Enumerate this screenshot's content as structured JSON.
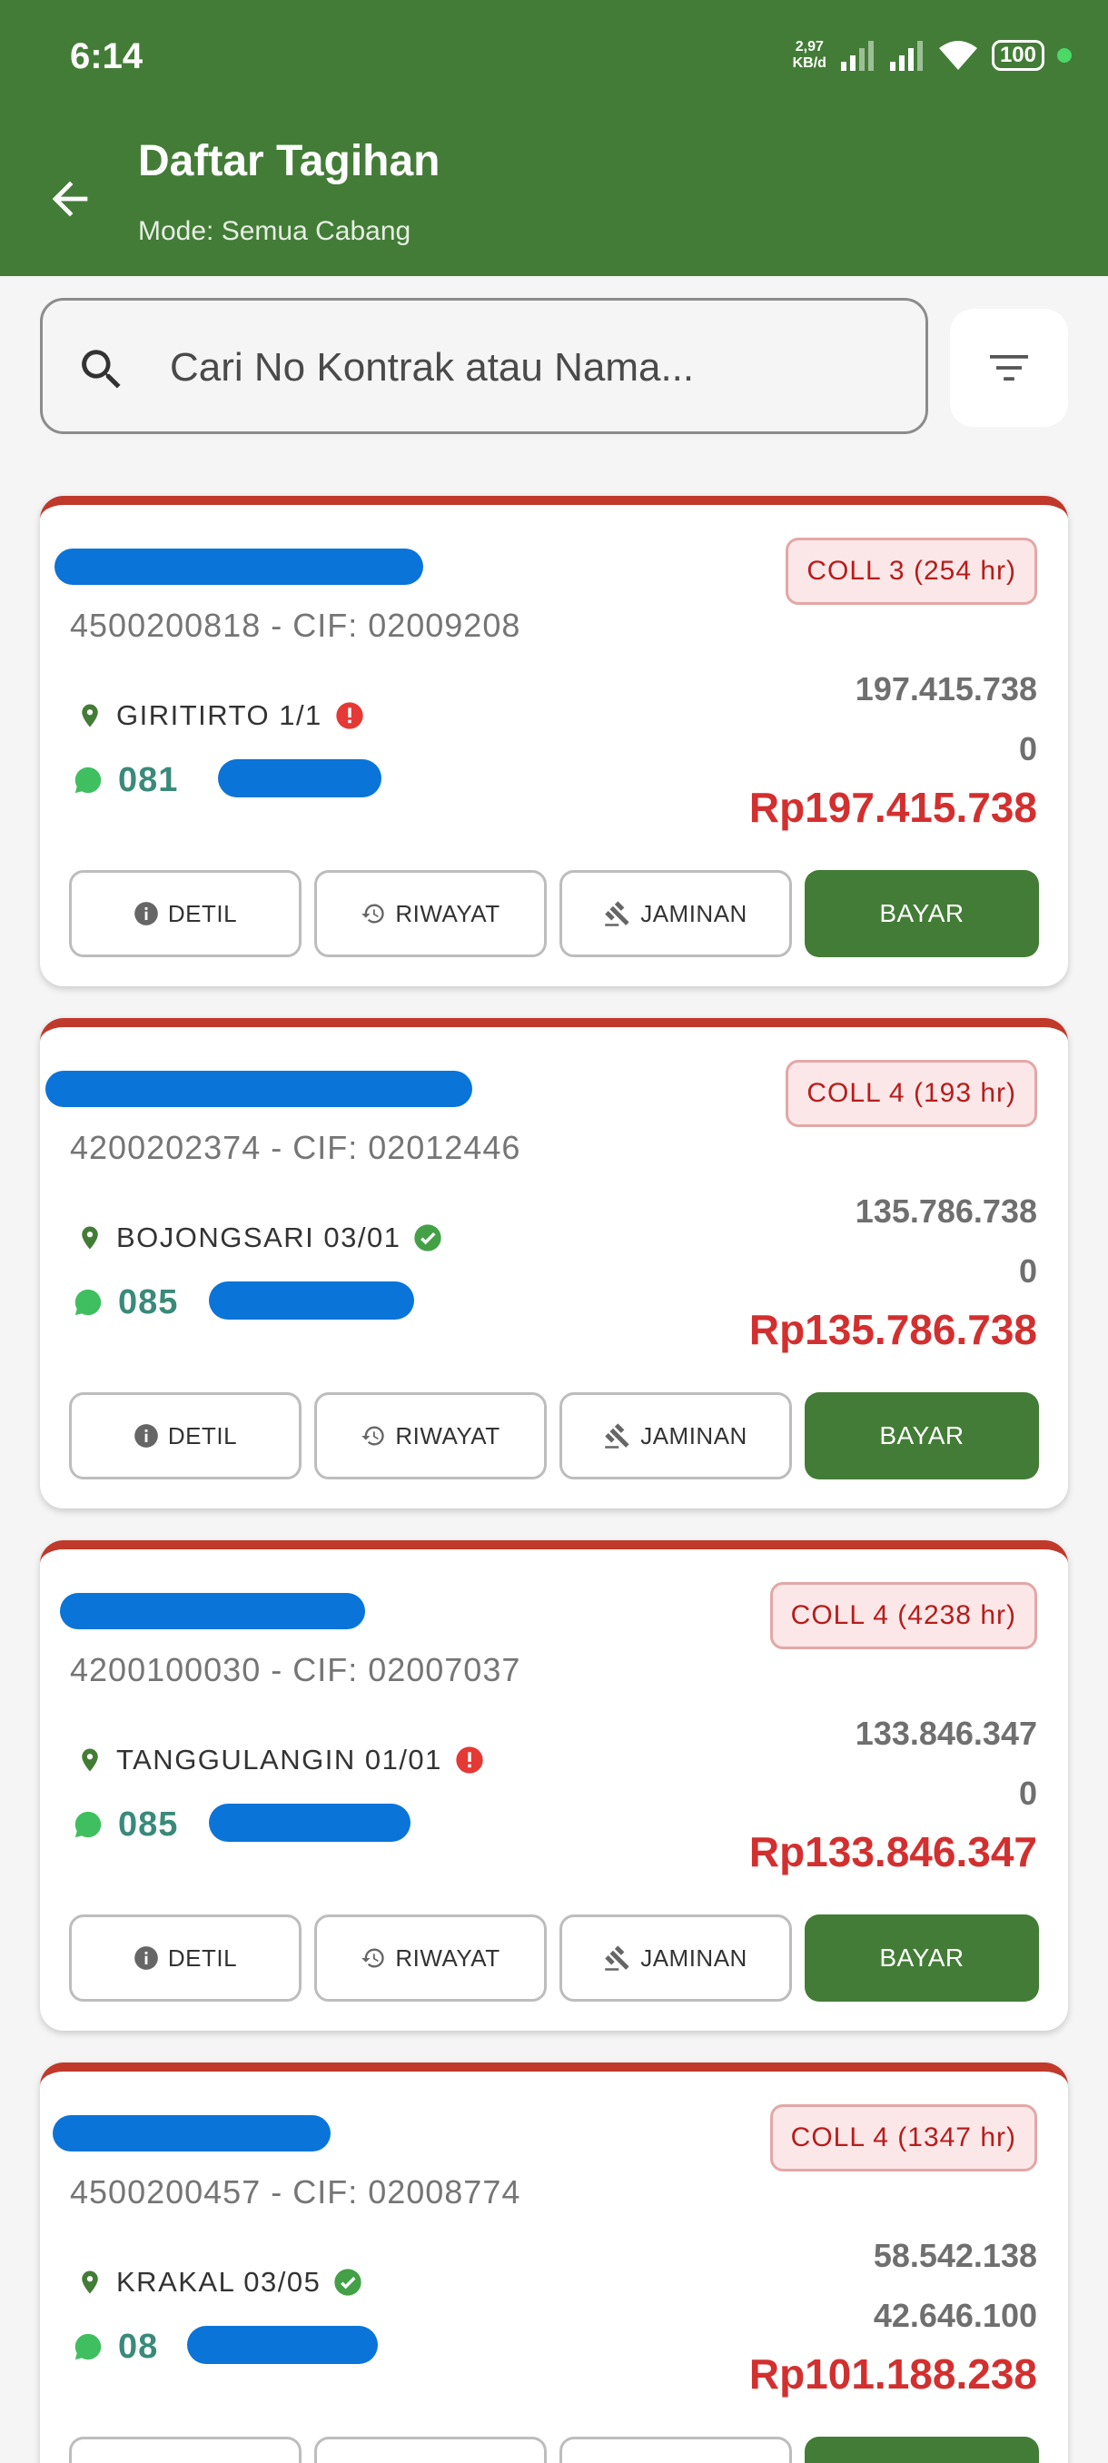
{
  "status_bar": {
    "time": "6:14",
    "net_speed_value": "2,97",
    "net_speed_unit": "KB/d",
    "battery": "100"
  },
  "header": {
    "title": "Daftar Tagihan",
    "subtitle": "Mode: Semua Cabang"
  },
  "search": {
    "placeholder": "Cari No Kontrak atau Nama..."
  },
  "colors": {
    "primary": "#437c36",
    "danger": "#d32f2f",
    "badge_bg": "#fbe7e7",
    "whatsapp": "#3fbf5f",
    "redaction": "#0a74d8"
  },
  "actions": {
    "detail": "DETIL",
    "history": "RIWAYAT",
    "collateral": "JAMINAN",
    "pay": "BAYAR"
  },
  "cards": [
    {
      "contract": "4500200818 - CIF: 02009208",
      "coll": "COLL 3 (254 hr)",
      "location": "GIRITIRTO 1/1",
      "location_status": "warning",
      "phone_prefix": "081",
      "amount_principal": "197.415.738",
      "amount_other": "0",
      "total": "Rp197.415.738"
    },
    {
      "contract": "4200202374 - CIF: 02012446",
      "coll": "COLL 4 (193 hr)",
      "location": "BOJONGSARI 03/01",
      "location_status": "verified",
      "phone_prefix": "085",
      "amount_principal": "135.786.738",
      "amount_other": "0",
      "total": "Rp135.786.738"
    },
    {
      "contract": "4200100030 - CIF: 02007037",
      "coll": "COLL 4 (4238 hr)",
      "location": "TANGGULANGIN 01/01",
      "location_status": "warning",
      "phone_prefix": "085",
      "amount_principal": "133.846.347",
      "amount_other": "0",
      "total": "Rp133.846.347"
    },
    {
      "contract": "4500200457 - CIF: 02008774",
      "coll": "COLL 4 (1347 hr)",
      "location": "KRAKAL 03/05",
      "location_status": "verified",
      "phone_prefix": "08",
      "amount_principal": "58.542.138",
      "amount_other": "42.646.100",
      "total": "Rp101.188.238"
    }
  ]
}
